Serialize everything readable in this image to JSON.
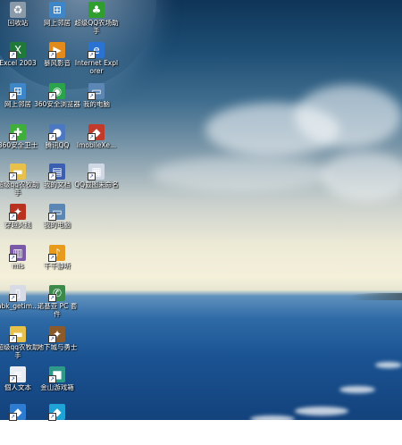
{
  "desktop": {
    "icons": [
      {
        "label": "回收站",
        "icon": "recycle-bin-icon",
        "color": "#8a9aa8"
      },
      {
        "label": "网上邻居",
        "icon": "network-icon",
        "color": "#3f86c9"
      },
      {
        "label": "超级QQ农场助手",
        "icon": "tree-icon",
        "color": "#2f9e2f"
      },
      {
        "label": "Excel 2003",
        "icon": "excel-icon",
        "color": "#1f7a3a"
      },
      {
        "label": "暴风影音",
        "icon": "media-player-icon",
        "color": "#e38a1c"
      },
      {
        "label": "Internet Explorer",
        "icon": "ie-icon",
        "color": "#2a72d4"
      },
      {
        "label": "网上邻居",
        "icon": "network-icon",
        "color": "#3f86c9"
      },
      {
        "label": "360安全浏览器",
        "icon": "browser-360-icon",
        "color": "#2aa34a"
      },
      {
        "label": "我的电脑",
        "icon": "computer-icon",
        "color": "#5c86b3"
      },
      {
        "label": "360安全卫士",
        "icon": "shield-icon",
        "color": "#3fae3a"
      },
      {
        "label": "腾讯QQ",
        "icon": "qq-icon",
        "color": "#4b78c0"
      },
      {
        "label": "ImobileXe...",
        "icon": "app-icon",
        "color": "#c23b2a"
      },
      {
        "label": "超级qq农牧助手",
        "icon": "folder-icon",
        "color": "#e8c14a"
      },
      {
        "label": "我的文档",
        "icon": "documents-icon",
        "color": "#3a5fb0"
      },
      {
        "label": "QQ截图未命名",
        "icon": "image-file-icon",
        "color": "#d0d8e6"
      },
      {
        "label": "穿越火线",
        "icon": "game-icon",
        "color": "#b8321f"
      },
      {
        "label": "我的电脑",
        "icon": "computer-icon",
        "color": "#5c86b3"
      },
      {
        "label": "mis",
        "icon": "archive-icon",
        "color": "#7a5aa8"
      },
      {
        "label": "千千静听",
        "icon": "music-player-icon",
        "color": "#e89a1c"
      },
      {
        "label": "abk_getim...",
        "icon": "file-icon",
        "color": "#d6dbe6"
      },
      {
        "label": "诺基亚 PC 套件",
        "icon": "phone-icon",
        "color": "#3b8a4c"
      },
      {
        "label": "超级qq农牧助手",
        "icon": "folder-icon",
        "color": "#e8c14a"
      },
      {
        "label": "地下城与勇士",
        "icon": "game-icon",
        "color": "#8a5a2a"
      },
      {
        "label": "個人文本",
        "icon": "text-file-icon",
        "color": "#e9eef5"
      },
      {
        "label": "金山游戏箱",
        "icon": "game-box-icon",
        "color": "#2f9a8a"
      },
      {
        "label": "",
        "icon": "app-icon",
        "color": "#2e7cd1"
      },
      {
        "label": "",
        "icon": "app-icon",
        "color": "#1fa3d6"
      }
    ]
  }
}
